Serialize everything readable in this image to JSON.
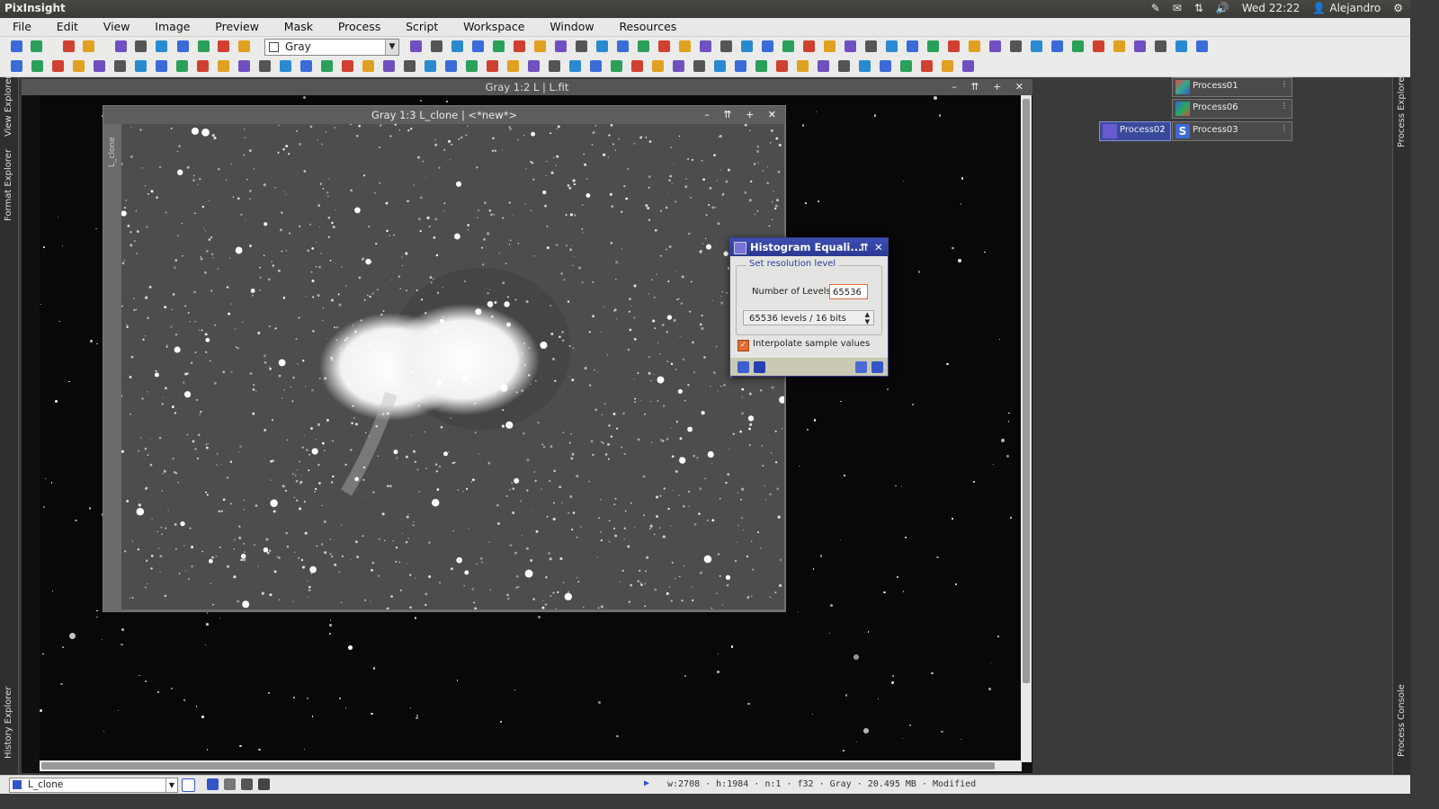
{
  "system_bar": {
    "app_name": "PixInsight",
    "clock": "Wed 22:22",
    "user": "Alejandro"
  },
  "menu": [
    "File",
    "Edit",
    "View",
    "Image",
    "Preview",
    "Mask",
    "Process",
    "Script",
    "Workspace",
    "Window",
    "Resources"
  ],
  "toolbar": {
    "channel_combo_value": "Gray"
  },
  "left_panels": {
    "view_explorer": "View Explorer",
    "format_explorer": "Format Explorer",
    "history_explorer": "History Explorer"
  },
  "right_panels": {
    "process_explorer": "Process Explorer",
    "process_console": "Process Console"
  },
  "windows": {
    "main": {
      "title": "Gray 1:2 L | L.fit"
    },
    "clone": {
      "title": "Gray 1:3 L_clone | <*new*>",
      "side_label": "L_clone"
    }
  },
  "dialog": {
    "title": "Histogram Equali...",
    "group_label": "Set resolution level",
    "levels_label": "Number of Levels:",
    "levels_value": "65536",
    "levels_select": "65536 levels / 16 bits",
    "interpolate_label": "Interpolate sample values",
    "interpolate_checked": true
  },
  "process_icons": [
    "Process01",
    "Process06",
    "Process02",
    "Process03"
  ],
  "status_bar": {
    "view": "L_clone",
    "info": "w:2708 · h:1984 · n:1 · f32 · Gray · 20.495 MB · Modified"
  },
  "colors": {
    "dialog_title": "#2a3891",
    "accent_orange": "#e36b2e",
    "workspace_bg": "#3a3a3a"
  }
}
